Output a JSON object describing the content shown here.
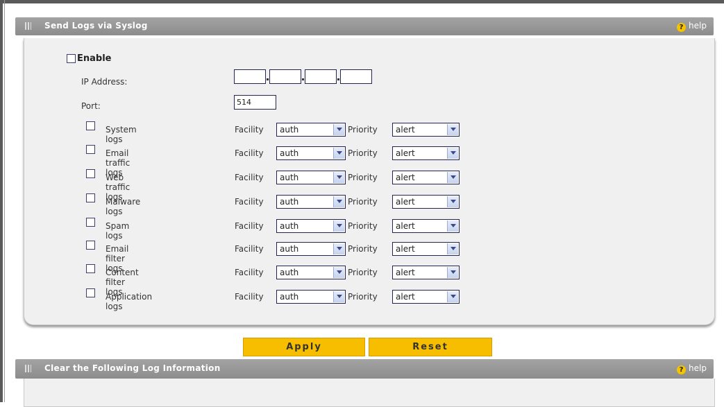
{
  "syslog_section": {
    "title": "Send Logs via Syslog",
    "help": "help",
    "enable_label": "Enable",
    "ip_label": "IP Address:",
    "ip_octets": [
      "",
      "",
      "",
      ""
    ],
    "port_label": "Port:",
    "port_value": "514",
    "facility_label": "Facility",
    "priority_label": "Priority",
    "log_rows": [
      {
        "label": "System logs",
        "facility": "auth",
        "priority": "alert"
      },
      {
        "label": "Email traffic logs",
        "facility": "auth",
        "priority": "alert"
      },
      {
        "label": "Web traffic logs",
        "facility": "auth",
        "priority": "alert"
      },
      {
        "label": "Malware logs",
        "facility": "auth",
        "priority": "alert"
      },
      {
        "label": "Spam logs",
        "facility": "auth",
        "priority": "alert"
      },
      {
        "label": "Email filter logs",
        "facility": "auth",
        "priority": "alert"
      },
      {
        "label": "Content filter logs",
        "facility": "auth",
        "priority": "alert"
      },
      {
        "label": "Application logs",
        "facility": "auth",
        "priority": "alert"
      }
    ]
  },
  "buttons": {
    "apply": "Apply",
    "reset": "Reset"
  },
  "clear_section": {
    "title": "Clear the Following Log Information",
    "help": "help"
  },
  "colors": {
    "header_bar": "#999999",
    "panel_bg": "#f0f0f0",
    "button_bg": "#f7be00"
  }
}
